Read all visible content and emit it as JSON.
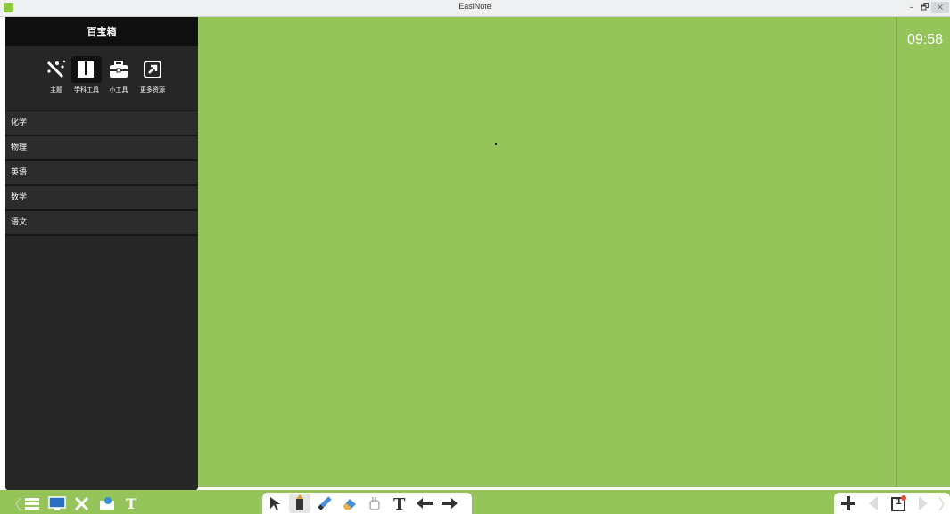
{
  "window": {
    "title": "EasiNote",
    "minimize": "–",
    "maximize": "🗗",
    "close": "×"
  },
  "clock": "09:58",
  "panel": {
    "title": "百宝箱",
    "tabs": [
      {
        "label": "主题",
        "icon": "magic-wand-icon"
      },
      {
        "label": "学科工具",
        "icon": "book-icon",
        "active": true
      },
      {
        "label": "小工具",
        "icon": "toolbox-icon"
      },
      {
        "label": "更多资源",
        "icon": "external-link-icon"
      }
    ],
    "subjects": [
      "化学",
      "物理",
      "英语",
      "数学",
      "语文"
    ]
  },
  "toolbar": {
    "left_icons": [
      "menu-icon",
      "screen-icon",
      "tools-icon",
      "cloud-folder-icon",
      "text-style-icon"
    ],
    "middle_icons": [
      "select-icon",
      "pen-icon",
      "highlighter-icon",
      "eraser-icon",
      "hand-icon",
      "text-icon",
      "undo-icon",
      "redo-icon"
    ],
    "right_icons": [
      "add-page-icon",
      "prev-page-icon",
      "page-icon",
      "next-page-icon"
    ],
    "page_number": "1"
  },
  "colors": {
    "canvas": "#95c55a",
    "panel": "#262626"
  }
}
